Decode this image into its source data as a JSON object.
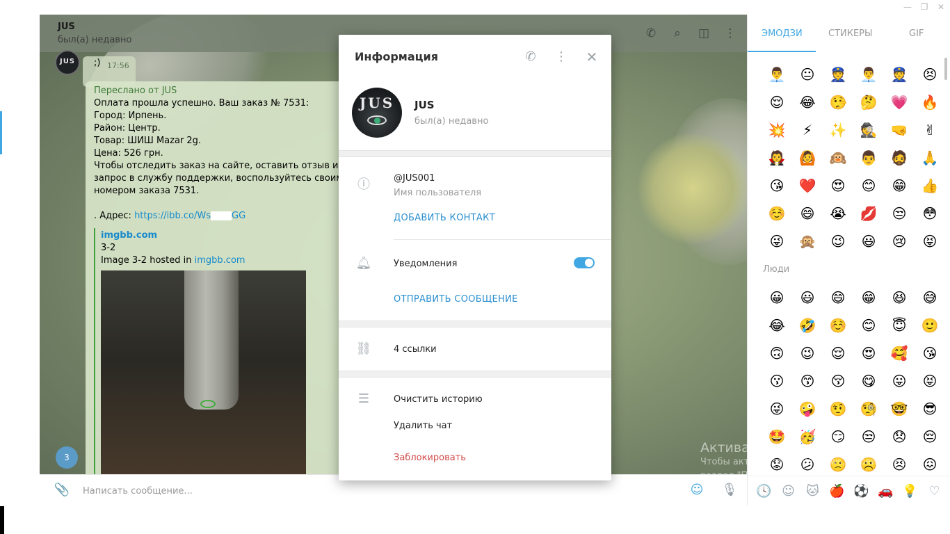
{
  "window_controls": {
    "minimize": "—",
    "restore": "❐",
    "close": "✕"
  },
  "chat": {
    "title": "JUS",
    "status": "был(а) недавно",
    "avatar_text": "JUS",
    "msg1": {
      "text": ";)",
      "time": "17:56"
    },
    "forwarded": "Переслано от JUS",
    "lines": [
      "Оплата прошла успешно. Ваш заказ № 7531:",
      "Город: Ирпень.",
      "Район: Центр.",
      "Товар:  ШИШ Mazar 2g.",
      "Цена: 526 грн.",
      "Чтобы отследить заказ на сайте, оставить отзыв или нап",
      "запрос в службу поддержки, воспользуйтесь своим /pin",
      "номером заказа 7531."
    ],
    "address_prefix": ". Адрес: ",
    "address_link": "https://ibb.co/Ws",
    "address_link_end": "GG",
    "preview_site": "imgbb.com",
    "preview_title": "3-2",
    "preview_desc": "Image 3-2 hosted in ",
    "preview_desc_link": "imgbb.com",
    "unread_count": "3"
  },
  "composer": {
    "placeholder": "Написать сообщение..."
  },
  "emoji_panel": {
    "tabs": [
      "ЭМОДЗИ",
      "СТИКЕРЫ",
      "GIF"
    ],
    "recent": [
      "👨‍💼",
      "😐",
      "👮",
      "👨‍💼",
      "👮",
      "😣",
      "😌",
      "😂",
      "🤥",
      "🤔",
      "💗",
      "🔥",
      "💥",
      "⚡",
      "✨",
      "🕵",
      "🤜",
      "✌",
      "🧛",
      "🙆",
      "🙉",
      "👨",
      "🧔",
      "🙏",
      "😘",
      "❤️",
      "😍",
      "😊",
      "😁",
      "👍",
      "☺️",
      "😄",
      "😭",
      "💋",
      "😒",
      "😳",
      "😜",
      "🙊",
      "😉",
      "😃",
      "😢",
      "😝"
    ],
    "section_people": "Люди",
    "people": [
      "😀",
      "😃",
      "😄",
      "😁",
      "😆",
      "😅",
      "😂",
      "🤣",
      "☺️",
      "😊",
      "😇",
      "🙂",
      "🙃",
      "😉",
      "😌",
      "😍",
      "🥰",
      "😘",
      "😗",
      "😙",
      "😚",
      "😋",
      "😛",
      "😝",
      "😜",
      "🤪",
      "🤨",
      "🧐",
      "🤓",
      "😎",
      "🤩",
      "🥳",
      "😏",
      "😒",
      "😞",
      "😔",
      "😟",
      "😕",
      "🙁",
      "☹️",
      "😣",
      "😖"
    ],
    "categories": [
      "🕓",
      "☺",
      "🐱",
      "🍎",
      "⚽",
      "🚗",
      "💡",
      "♡"
    ]
  },
  "watermark": {
    "line1": "Активация Windows",
    "line2": "Чтобы активировать Windows, перейдите в",
    "line3": "раздел \"Параметры\"."
  },
  "modal": {
    "title": "Информация",
    "name": "JUS",
    "status": "был(а) недавно",
    "avatar_text": "JUS",
    "username": "@JUS001",
    "username_label": "Имя пользователя",
    "add_contact": "ДОБАВИТЬ КОНТАКТ",
    "notifications": "Уведомления",
    "notifications_on": true,
    "send_message": "ОТПРАВИТЬ СООБЩЕНИЕ",
    "links": "4 ссылки",
    "clear_history": "Очистить историю",
    "delete_chat": "Удалить чат",
    "block": "Заблокировать"
  },
  "colors": {
    "accent": "#40a7e3",
    "danger": "#d24949",
    "link": "#2a8fd0",
    "forward": "#3e7b3a"
  }
}
